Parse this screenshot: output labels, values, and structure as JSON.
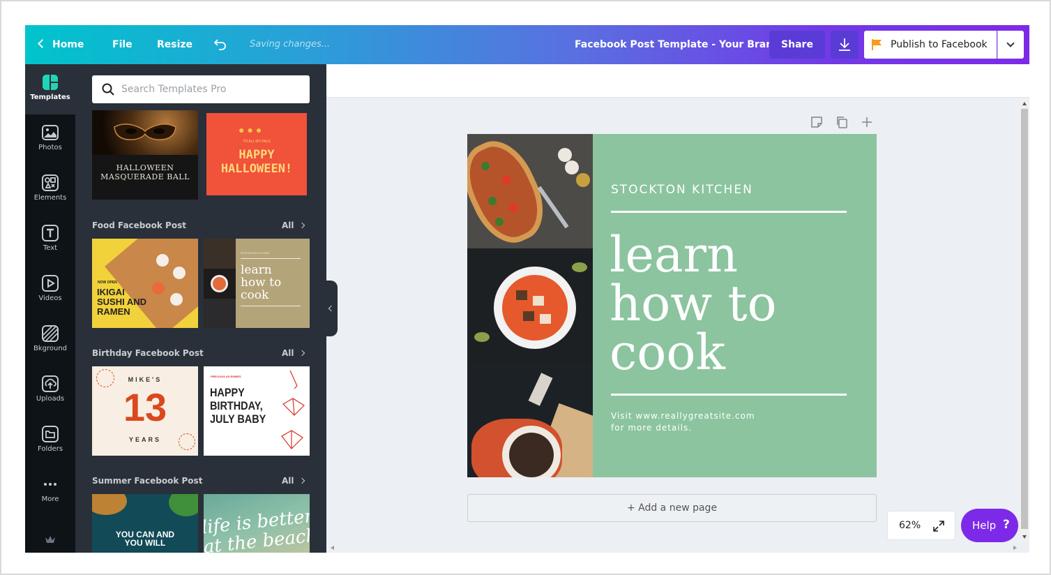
{
  "topbar": {
    "home_label": "Home",
    "file_label": "File",
    "resize_label": "Resize",
    "saving_text": "Saving changes...",
    "doc_title": "Facebook Post Template - Your Brand",
    "share_label": "Share",
    "publish_label": "Publish to Facebook"
  },
  "rail": {
    "items": [
      {
        "label": "Templates",
        "icon": "templates-icon"
      },
      {
        "label": "Photos",
        "icon": "photos-icon"
      },
      {
        "label": "Elements",
        "icon": "elements-icon"
      },
      {
        "label": "Text",
        "icon": "text-icon"
      },
      {
        "label": "Videos",
        "icon": "videos-icon"
      },
      {
        "label": "Bkground",
        "icon": "background-icon"
      },
      {
        "label": "Uploads",
        "icon": "uploads-icon"
      },
      {
        "label": "Folders",
        "icon": "folders-icon"
      },
      {
        "label": "More",
        "icon": "more-icon"
      }
    ]
  },
  "panel": {
    "search_placeholder": "Search Templates Pro",
    "sections": [
      {
        "title": "Food Facebook Post",
        "all": "All"
      },
      {
        "title": "Birthday Facebook Post",
        "all": "All"
      },
      {
        "title": "Summer Facebook Post",
        "all": "All"
      }
    ],
    "thumbs": {
      "halloween_ball": {
        "line1": "HALLOWEEN",
        "line2": "MASQUERADE BALL"
      },
      "happy_halloween": {
        "small": "TO ALL MY PALS",
        "line1": "HAPPY",
        "line2": "HALLOWEEN!"
      },
      "sushi": {
        "small": "NOW OPEN",
        "line1": "IKIGAI",
        "line2": "SUSHI AND",
        "line3": "RAMEN"
      },
      "cook": {
        "small": "STOCKTON KITCHEN",
        "line1": "learn",
        "line2": "how to",
        "line3": "cook"
      },
      "mikes": {
        "top": "MIKE'S",
        "num": "13",
        "bottom": "YEARS"
      },
      "july": {
        "small": "PRECIOUS AS RUBIES",
        "line1": "HAPPY",
        "line2": "BIRTHDAY,",
        "line3": "JULY BABY"
      },
      "youcan": {
        "line1": "YOU CAN AND",
        "line2": "YOU WILL"
      },
      "beach": {
        "line1": "life is better",
        "line2": "at the beach"
      }
    }
  },
  "design": {
    "brand": "STOCKTON KITCHEN",
    "headline_1": "learn",
    "headline_2": "how to",
    "headline_3": "cook",
    "visit": "Visit www.reallygreatsite.com\nfor more details."
  },
  "editor": {
    "add_page_label": "+ Add a new page",
    "zoom": "62%",
    "help_label": "Help",
    "help_q": "?"
  },
  "colors": {
    "accent_purple": "#7d2ae8",
    "teal": "#00c4cc",
    "design_green": "#8bc49f",
    "panel_bg": "#293039",
    "rail_bg": "#0e1318"
  }
}
